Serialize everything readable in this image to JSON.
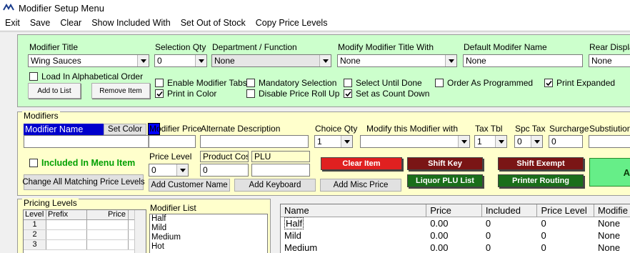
{
  "window": {
    "title": "Modifier Setup Menu"
  },
  "menu": [
    "Exit",
    "Save",
    "Clear",
    "Show Included With",
    "Set Out of Stock",
    "Copy Price Levels"
  ],
  "top": {
    "modifier_title_label": "Modifier Title",
    "modifier_title_value": "Wing Sauces",
    "selection_qty_label": "Selection Qty",
    "selection_qty_value": "0",
    "department_label": "Department / Function",
    "department_value": "None",
    "modify_title_with_label": "Modify Modifier Title With",
    "modify_title_with_value": "None",
    "default_name_label": "Default Modifer Name",
    "default_name_value": "None",
    "rear_display_label": "Rear Display",
    "rear_display_value": "None",
    "load_alpha_label": "Load In Alphabetical Order",
    "add_to_list_label": "Add to List",
    "remove_item_label": "Remove Item",
    "checkboxes": {
      "enable_tabs": {
        "label": "Enable Modifier Tabs",
        "checked": false
      },
      "print_in_color": {
        "label": "Print in Color",
        "checked": true
      },
      "mandatory": {
        "label": "Mandatory Selection",
        "checked": false
      },
      "disable_rollup": {
        "label": "Disable Price Roll Up",
        "checked": false
      },
      "select_until_done": {
        "label": "Select Until Done",
        "checked": false
      },
      "count_down": {
        "label": "Set as Count Down",
        "checked": true
      },
      "order_programmed": {
        "label": "Order As Programmed",
        "checked": false
      },
      "print_expanded": {
        "label": "Print Expanded",
        "checked": true
      }
    }
  },
  "modifiers": {
    "section_label": "Modifiers",
    "name_label": "Modifier Name",
    "set_color_label": "Set Color",
    "swatch_color": "#0000ff",
    "price_label": "Modifier Price",
    "alt_desc_label": "Alternate Description",
    "choice_qty_label": "Choice Qty",
    "choice_qty_value": "1",
    "modify_with_label": "Modify this Modifier with",
    "tax_tbl_label": "Tax Tbl",
    "tax_tbl_value": "1",
    "spc_tax_label": "Spc Tax",
    "spc_tax_value": "0",
    "surcharge_label": "Surcharge",
    "surcharge_value": "0",
    "substitution_label": "Substiution M",
    "included_label": "Included In Menu Item",
    "price_level_label": "Price Level",
    "price_level_value": "0",
    "product_cost_label": "Product Cost",
    "product_cost_value": "0",
    "plu_label": "PLU",
    "change_all_label": "Change All Matching Price Levels",
    "add_customer_label": "Add Customer Name",
    "add_keyboard_label": "Add Keyboard",
    "add_misc_label": "Add Misc Price",
    "clear_item_label": "Clear Item",
    "shift_key_label": "Shift Key",
    "shift_exempt_label": "Shift Exempt",
    "liquor_plu_label": "Liquor PLU List",
    "printer_routing_label": "Printer Routing",
    "add_big_label": "Ad"
  },
  "pricing": {
    "section_label": "Pricing Levels",
    "headers": [
      "Level",
      "Prefix",
      "Price"
    ],
    "rows": [
      "1",
      "2",
      "3"
    ]
  },
  "modifier_list": {
    "label": "Modifier List",
    "items": [
      "Half",
      "Mild",
      "Medium",
      "Hot"
    ]
  },
  "table": {
    "headers": [
      "Name",
      "Price",
      "Included",
      "Price Level",
      "Modifie"
    ],
    "rows": [
      [
        "Half",
        "0.00",
        "0",
        "0",
        "None"
      ],
      [
        "Mild",
        "0.00",
        "0",
        "0",
        "None"
      ],
      [
        "Medium",
        "0.00",
        "0",
        "0",
        "None"
      ]
    ]
  },
  "colors": {
    "top_panel": "#ccffcc",
    "mid_panel": "#ffffcc",
    "red_button": "#e02020",
    "dark_red_button": "#7a1515",
    "green_button": "#1a6e1a"
  }
}
